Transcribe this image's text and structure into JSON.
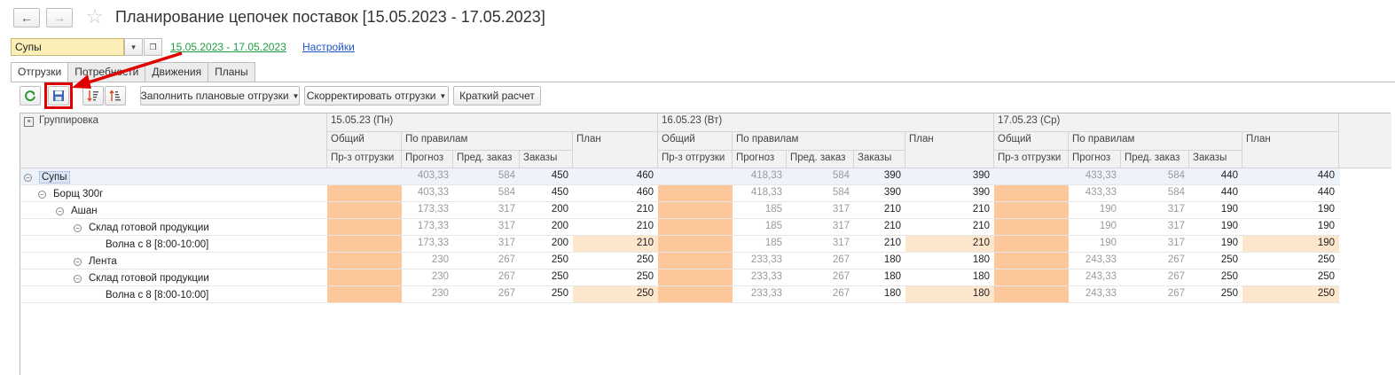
{
  "window": {
    "title": "Планирование цепочек поставок [15.05.2023 - 17.05.2023]",
    "back_icon": "arrow-left-icon",
    "forward_icon": "arrow-right-icon",
    "favorite_icon": "star-icon"
  },
  "filter": {
    "category_value": "Супы",
    "period_link": "15.05.2023 - 17.05.2023",
    "settings_link": "Настройки"
  },
  "tabs": [
    {
      "label": "Отгрузки",
      "active": true
    },
    {
      "label": "Потребности",
      "active": false
    },
    {
      "label": "Движения",
      "active": false
    },
    {
      "label": "Планы",
      "active": false
    }
  ],
  "toolbar": {
    "refresh_icon": "refresh-icon",
    "save_icon": "save-icon",
    "sort_desc_icon": "sort-descending-icon",
    "sort_asc_icon": "sort-ascending-icon",
    "fill_button": "Заполнить плановые отгрузки",
    "adjust_button": "Скорректировать отгрузки",
    "calc_button": "Краткий расчет"
  },
  "grid": {
    "grouping_header": "Группировка",
    "days": [
      "15.05.23 (Пн)",
      "16.05.23 (Вт)",
      "17.05.23 (Ср)"
    ],
    "sub": {
      "total": "Общий",
      "by_rules": "По правилам",
      "plan": "План",
      "production_shipment": "Пр-з отгрузки",
      "forecast": "Прогноз",
      "prev_order": "Пред. заказ",
      "orders": "Заказы"
    },
    "rows": [
      {
        "label": "Супы",
        "values": [
          [
            "403,33",
            "584",
            "450",
            "460"
          ],
          [
            "418,33",
            "584",
            "390",
            "390"
          ],
          [
            "433,33",
            "584",
            "440",
            "440"
          ]
        ]
      },
      {
        "label": "Борщ 300г",
        "values": [
          [
            "403,33",
            "584",
            "450",
            "460"
          ],
          [
            "418,33",
            "584",
            "390",
            "390"
          ],
          [
            "433,33",
            "584",
            "440",
            "440"
          ]
        ]
      },
      {
        "label": "Ашан",
        "values": [
          [
            "173,33",
            "317",
            "200",
            "210"
          ],
          [
            "185",
            "317",
            "210",
            "210"
          ],
          [
            "190",
            "317",
            "190",
            "190"
          ]
        ]
      },
      {
        "label": "Склад готовой продукции",
        "values": [
          [
            "173,33",
            "317",
            "200",
            "210"
          ],
          [
            "185",
            "317",
            "210",
            "210"
          ],
          [
            "190",
            "317",
            "190",
            "190"
          ]
        ]
      },
      {
        "label": "Волна с 8 [8:00-10:00]",
        "values": [
          [
            "173,33",
            "317",
            "200",
            "210"
          ],
          [
            "185",
            "317",
            "210",
            "210"
          ],
          [
            "190",
            "317",
            "190",
            "190"
          ]
        ]
      },
      {
        "label": "Лента",
        "values": [
          [
            "230",
            "267",
            "250",
            "250"
          ],
          [
            "233,33",
            "267",
            "180",
            "180"
          ],
          [
            "243,33",
            "267",
            "250",
            "250"
          ]
        ]
      },
      {
        "label": "Склад готовой продукции",
        "values": [
          [
            "230",
            "267",
            "250",
            "250"
          ],
          [
            "233,33",
            "267",
            "180",
            "180"
          ],
          [
            "243,33",
            "267",
            "250",
            "250"
          ]
        ]
      },
      {
        "label": "Волна с 8 [8:00-10:00]",
        "values": [
          [
            "230",
            "267",
            "250",
            "250"
          ],
          [
            "233,33",
            "267",
            "180",
            "180"
          ],
          [
            "243,33",
            "267",
            "250",
            "250"
          ]
        ]
      }
    ]
  },
  "annotation": {
    "highlight_color": "#e00000"
  }
}
